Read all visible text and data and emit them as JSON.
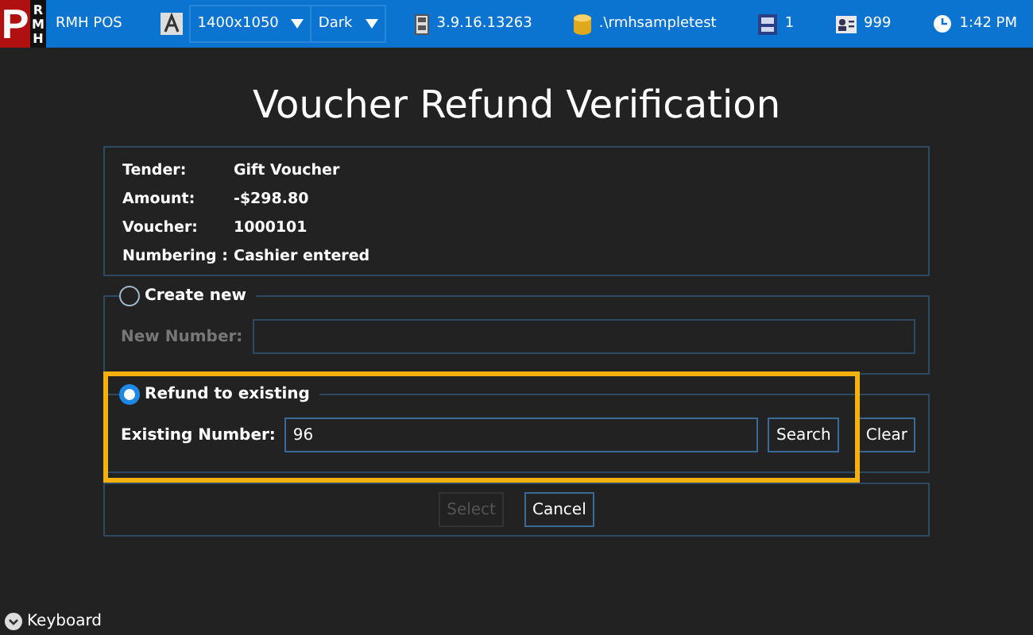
{
  "top_bar": {
    "logo": {
      "main_letter": "P",
      "side_letters": [
        "R",
        "M",
        "H"
      ]
    },
    "app_name": "RMH POS",
    "resolution": "1400x1050",
    "theme": "Dark",
    "version": "3.9.16.13263",
    "database": ".\\rmhsampletest",
    "register": "1",
    "cashier": "999",
    "time": "1:42 PM"
  },
  "title": "Voucher Refund Verification",
  "details": [
    {
      "label": "Tender:",
      "value": "Gift Voucher"
    },
    {
      "label": "Amount:",
      "value": "-$298.80"
    },
    {
      "label": "Voucher:",
      "value": "1000101"
    },
    {
      "label": "Numbering :",
      "value": "Cashier entered"
    }
  ],
  "options": [
    {
      "label": "Create new",
      "selected": false,
      "highlighted": false,
      "field_label": "New Number:"
    },
    {
      "label": "Refund to existing",
      "selected": true,
      "highlighted": true,
      "field_label": "Existing Number:",
      "value": "96",
      "buttons": [
        "Search",
        "Clear"
      ]
    }
  ],
  "actions": [
    {
      "label": "Select",
      "disabled": true
    },
    {
      "label": "Cancel",
      "disabled": false
    }
  ],
  "keyboard_toggle": "Keyboard"
}
